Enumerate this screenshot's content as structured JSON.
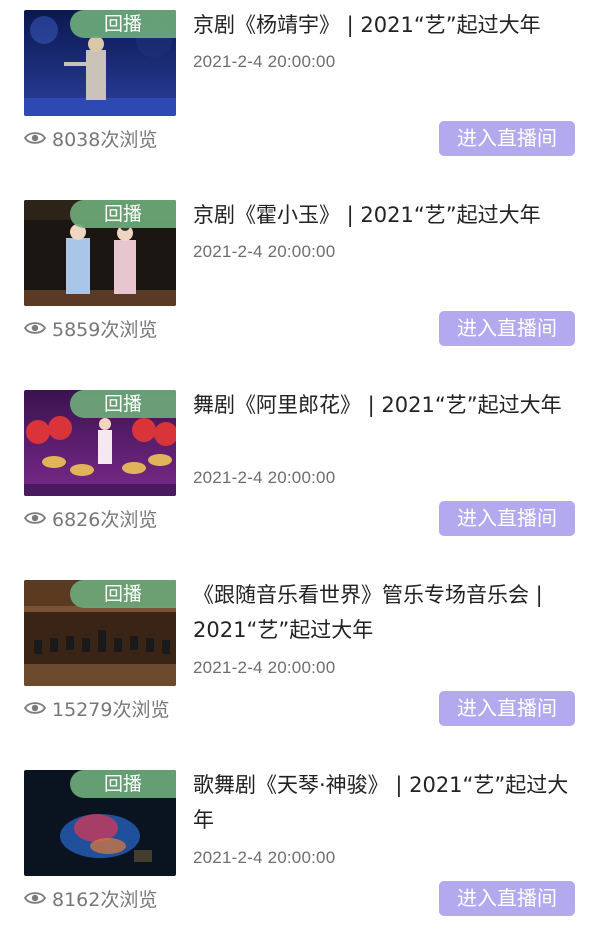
{
  "items": [
    {
      "badge": "回播",
      "title": "京剧《杨靖宇》 | 2021“艺”起过大年",
      "date": "2021-2-4 20:00:00",
      "views": "8038次浏览",
      "button": "进入直播间"
    },
    {
      "badge": "回播",
      "title": "京剧《霍小玉》 | 2021“艺”起过大年",
      "date": "2021-2-4 20:00:00",
      "views": "5859次浏览",
      "button": "进入直播间"
    },
    {
      "badge": "回播",
      "title": "舞剧《阿里郎花》 | 2021“艺”起过大年",
      "date": "2021-2-4 20:00:00",
      "views": "6826次浏览",
      "button": "进入直播间"
    },
    {
      "badge": "回播",
      "title": "《跟随音乐看世界》管乐专场音乐会 | 2021“艺”起过大年",
      "date": "2021-2-4 20:00:00",
      "views": "15279次浏览",
      "button": "进入直播间"
    },
    {
      "badge": "回播",
      "title": "歌舞剧《天琴·神骏》 | 2021“艺”起过大年",
      "date": "2021-2-4 20:00:00",
      "views": "8162次浏览",
      "button": "进入直播间"
    }
  ],
  "colors": {
    "badge_bg": "#6caa7a",
    "button_bg": "#b3a9ef",
    "muted_text": "#777777"
  },
  "icons": {
    "views": "eye-icon"
  }
}
